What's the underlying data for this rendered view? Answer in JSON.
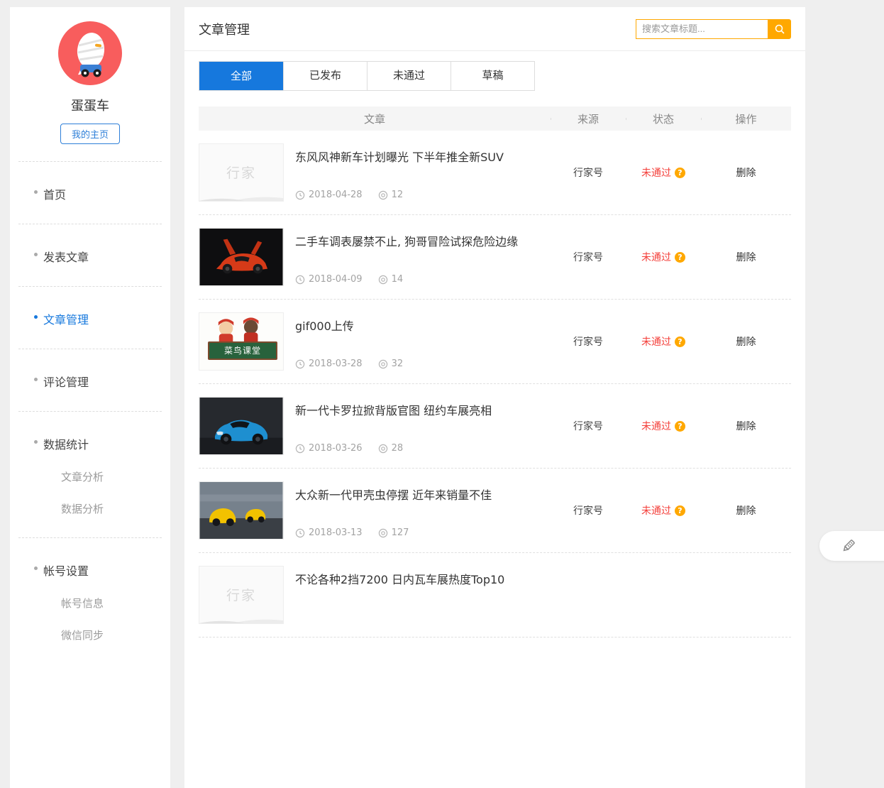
{
  "colors": {
    "accent": "#1678dd",
    "orange": "#ffa800",
    "status_red": "#f43f3a",
    "avatar_red": "#f85d5d"
  },
  "sidebar": {
    "username": "蛋蛋车",
    "homepage_button": "我的主页",
    "items": [
      {
        "label": "首页",
        "active": false
      },
      {
        "label": "发表文章",
        "active": false
      },
      {
        "label": "文章管理",
        "active": true
      },
      {
        "label": "评论管理",
        "active": false
      },
      {
        "label": "数据统计",
        "active": false
      },
      {
        "label": "帐号设置",
        "active": false
      }
    ],
    "stats_children": [
      {
        "label": "文章分析"
      },
      {
        "label": "数据分析"
      }
    ],
    "account_children": [
      {
        "label": "帐号信息"
      },
      {
        "label": "微信同步"
      }
    ]
  },
  "header": {
    "title": "文章管理"
  },
  "search": {
    "placeholder": "搜索文章标题..."
  },
  "tabs": {
    "items": [
      {
        "label": "全部",
        "active": true
      },
      {
        "label": "已发布",
        "active": false
      },
      {
        "label": "未通过",
        "active": false
      },
      {
        "label": "草稿",
        "active": false
      }
    ]
  },
  "table": {
    "columns": {
      "article": "文章",
      "source": "来源",
      "status": "状态",
      "action": "操作"
    },
    "rows": [
      {
        "title": "东风风神新车计划曝光 下半年推全新SUV",
        "date": "2018-04-28",
        "views": "12",
        "source": "行家号",
        "status": "未通过",
        "status_help": "?",
        "action": "删除",
        "thumb_text": "行家"
      },
      {
        "title": "二手车调表屡禁不止, 狗哥冒险试探危险边缘",
        "date": "2018-04-09",
        "views": "14",
        "source": "行家号",
        "status": "未通过",
        "status_help": "?",
        "action": "删除"
      },
      {
        "title": "gif000上传",
        "date": "2018-03-28",
        "views": "32",
        "source": "行家号",
        "status": "未通过",
        "status_help": "?",
        "action": "删除",
        "thumb_text": "菜鸟课堂"
      },
      {
        "title": "新一代卡罗拉掀背版官图 纽约车展亮相",
        "date": "2018-03-26",
        "views": "28",
        "source": "行家号",
        "status": "未通过",
        "status_help": "?",
        "action": "删除"
      },
      {
        "title": "大众新一代甲壳虫停摆 近年来销量不佳",
        "date": "2018-03-13",
        "views": "127",
        "source": "行家号",
        "status": "未通过",
        "status_help": "?",
        "action": "删除"
      },
      {
        "title": "不论各种2挡7200 日内瓦车展热度Top10",
        "thumb_text": "行家"
      }
    ]
  },
  "icons": {
    "search": "search-icon",
    "date": "clock-icon",
    "views": "eye-icon",
    "status_help": "question-icon",
    "fab": "pencil-icon"
  }
}
